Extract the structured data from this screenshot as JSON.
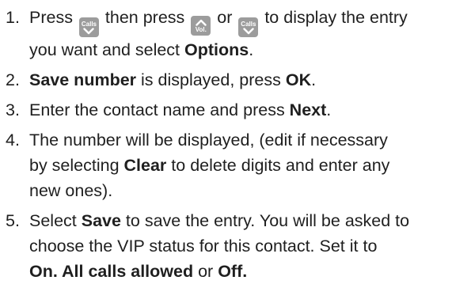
{
  "steps": [
    {
      "num": "1.",
      "line1": {
        "a": "Press ",
        "b": " then press ",
        "c": " or ",
        "d": " to display the entry"
      },
      "line2": {
        "a": "you want and select ",
        "bold": "Options",
        "end": "."
      },
      "keys": {
        "calls_label": "Calls",
        "calls_icon": "calls-down-icon",
        "vol_label": "Vol.",
        "vol_icon": "vol-up-icon"
      }
    },
    {
      "num": "2.",
      "bold1": "Save number",
      "text1": " is displayed, press ",
      "bold2": "OK",
      "end": "."
    },
    {
      "num": "3.",
      "text1": "Enter the contact name and press ",
      "bold1": "Next",
      "end": "."
    },
    {
      "num": "4.",
      "line1": "The number will be displayed, (edit if necessary",
      "line2": {
        "a": "by selecting ",
        "bold": "Clear",
        "b": " to delete digits and enter any"
      },
      "line3": "new ones)."
    },
    {
      "num": "5.",
      "line1": {
        "a": "Select ",
        "bold": "Save",
        "b": " to save the entry. You will be asked to"
      },
      "line2": "choose the VIP status for this contact. Set it to",
      "line3": {
        "bold1": "On. All calls allowed",
        "mid": " or ",
        "bold2": "Off",
        "end": "."
      }
    }
  ],
  "colors": {
    "text": "#1f1f1f",
    "key_bg": "#9c9c9c",
    "key_fg": "#ffffff"
  }
}
